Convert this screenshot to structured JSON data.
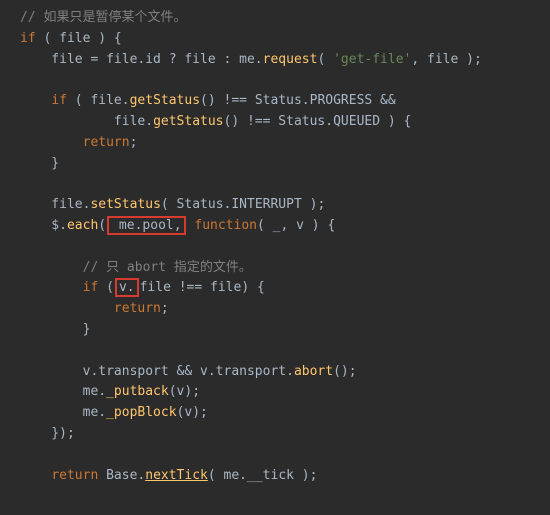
{
  "code": {
    "l1_comment": "// 如果只是暂停某个文件。",
    "l2_if": "if",
    "l2_open": " ( file ) {",
    "l3_a": "    file = file.id ? file : me.",
    "l3_req": "request",
    "l3_b": "( ",
    "l3_str": "'get-file'",
    "l3_c": ", file );",
    "l5_if": "if",
    "l5_a": " ( file.",
    "l5_get": "getStatus",
    "l5_b": "() !== Status.PROGRESS &&",
    "l6_a": "            file.",
    "l6_get": "getStatus",
    "l6_b": "() !== Status.QUEUED ) {",
    "l7_return": "return",
    "l7_semi": ";",
    "l8_close": "    }",
    "l10_a": "    file.",
    "l10_set": "setStatus",
    "l10_b": "( Status.INTERRUPT );",
    "l11_a": "    $.",
    "l11_each": "each",
    "l11_b": "(",
    "l11_hl": " me.pool,",
    "l11_c": " ",
    "l11_func": "function",
    "l11_d": "( _, v ) {",
    "l13_comment": "        // 只 abort 指定的文件。",
    "l14_if": "if",
    "l14_a": " (",
    "l14_hl": "v.",
    "l14_b": "file !== file) {",
    "l15_return": "return",
    "l15_semi": ";",
    "l16_close": "        }",
    "l18_a": "        v.transport && v.transport.",
    "l18_abort": "abort",
    "l18_b": "();",
    "l19_a": "        me.",
    "l19_put": "_putback",
    "l19_b": "(v);",
    "l20_a": "        me.",
    "l20_pop": "_popBlock",
    "l20_b": "(v);",
    "l21_close": "    });",
    "l23_ret": "return",
    "l23_a": " Base.",
    "l23_nt": "nextTick",
    "l23_b": "( me.__tick );"
  }
}
